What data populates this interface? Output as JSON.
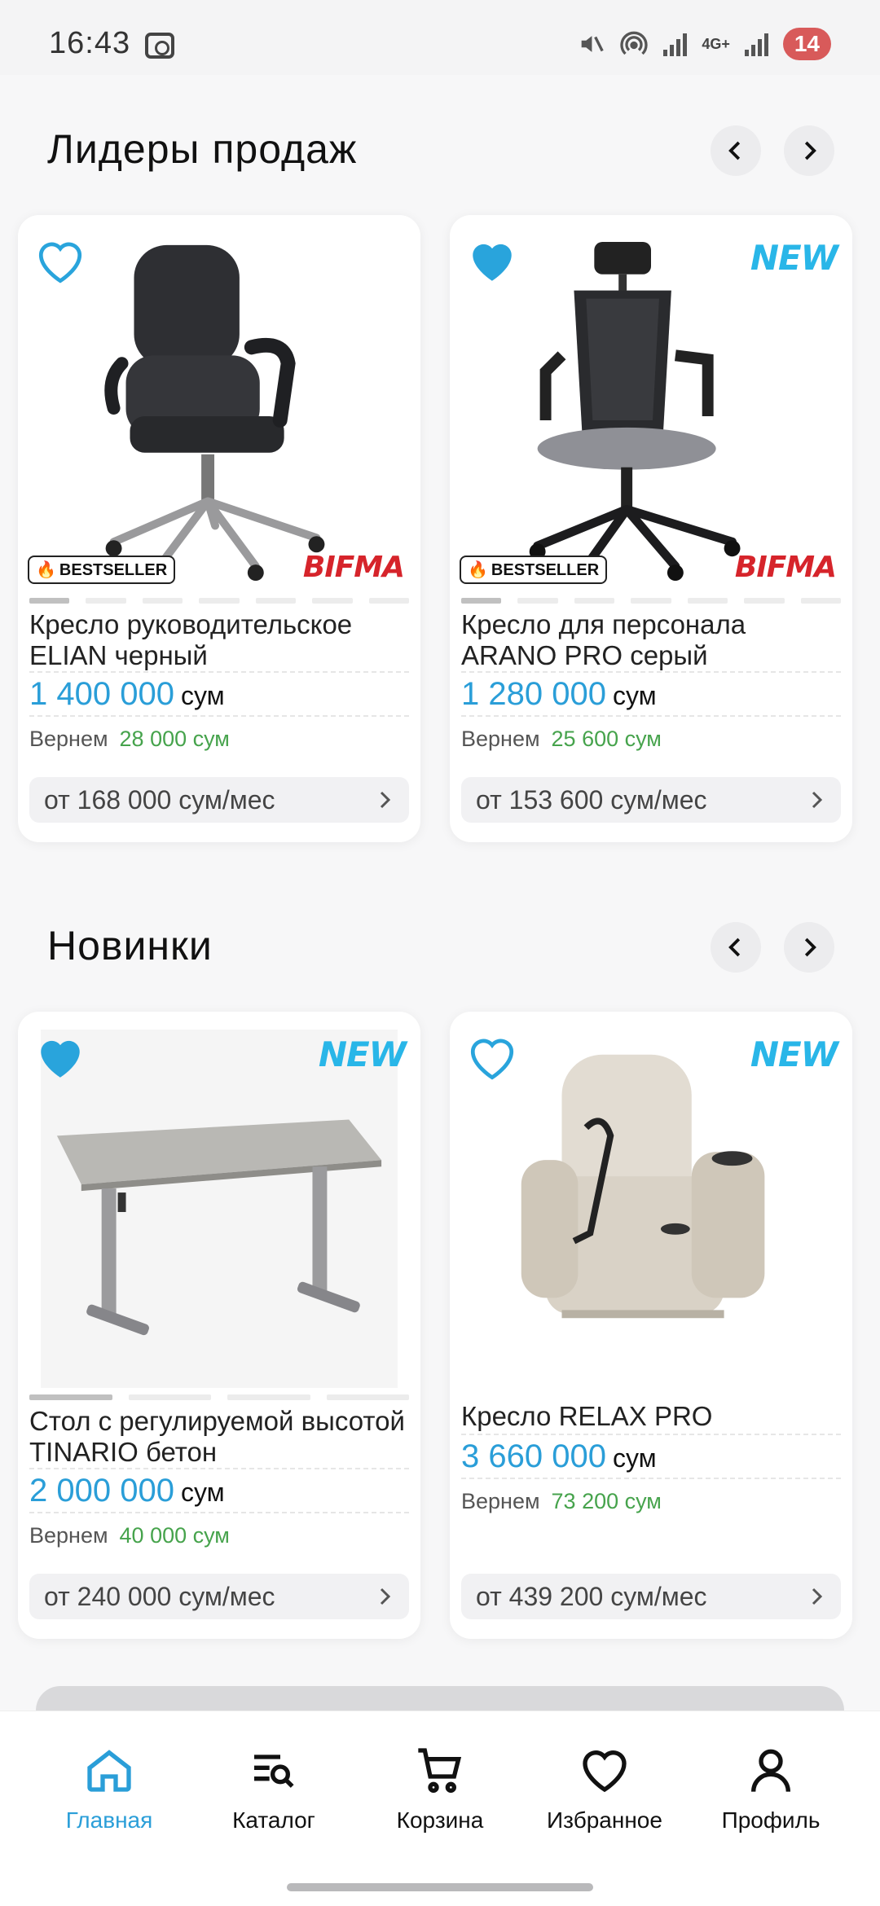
{
  "status_bar": {
    "time": "16:43",
    "network": "4G+",
    "battery": "14"
  },
  "sections": [
    {
      "title": "Лидеры продаж",
      "products": [
        {
          "name": "Кресло руководительское ELIAN  черный",
          "price": "1 400 000",
          "currency": "сум",
          "cashback_label": "Вернем",
          "cashback": "28 000 сум",
          "installment": "от 168 000 сум/мес",
          "favorite": false,
          "is_new": false,
          "bestseller": "BESTSELLER",
          "brand": "BIFMA",
          "image": "office-chair-black"
        },
        {
          "name": "Кресло для персонала ARANO PRO серый",
          "price": "1 280 000",
          "currency": "сум",
          "cashback_label": "Вернем",
          "cashback": "25 600 сум",
          "installment": "от 153 600 сум/мес",
          "favorite": true,
          "is_new": true,
          "new_label": "NEW",
          "bestseller": "BESTSELLER",
          "brand": "BIFMA",
          "image": "mesh-chair-grey"
        }
      ]
    },
    {
      "title": "Новинки",
      "products": [
        {
          "name": " Стол с регулируемой высотой TINARIO бетон",
          "price": "2 000 000",
          "currency": "сум",
          "cashback_label": "Вернем",
          "cashback": "40 000 сум",
          "installment": "от 240 000 сум/мес",
          "favorite": true,
          "is_new": true,
          "new_label": "NEW",
          "image": "standing-desk"
        },
        {
          "name": "Кресло RELAX PRO",
          "price": "3 660 000",
          "currency": "сум",
          "cashback_label": "Вернем",
          "cashback": "73 200 сум",
          "installment": "от 439 200 сум/мес",
          "favorite": false,
          "is_new": true,
          "new_label": "NEW",
          "image": "recliner-beige"
        }
      ]
    }
  ],
  "tabbar": [
    {
      "label": "Главная",
      "icon": "home-icon",
      "active": true
    },
    {
      "label": "Каталог",
      "icon": "catalog-search-icon",
      "active": false
    },
    {
      "label": "Корзина",
      "icon": "cart-icon",
      "active": false
    },
    {
      "label": "Избранное",
      "icon": "heart-icon",
      "active": false
    },
    {
      "label": "Профиль",
      "icon": "user-icon",
      "active": false
    }
  ],
  "colors": {
    "accent": "#2a9ed8",
    "cashback": "#46a34c",
    "brand_red": "#d6242b",
    "new_badge": "#29b6e8"
  }
}
